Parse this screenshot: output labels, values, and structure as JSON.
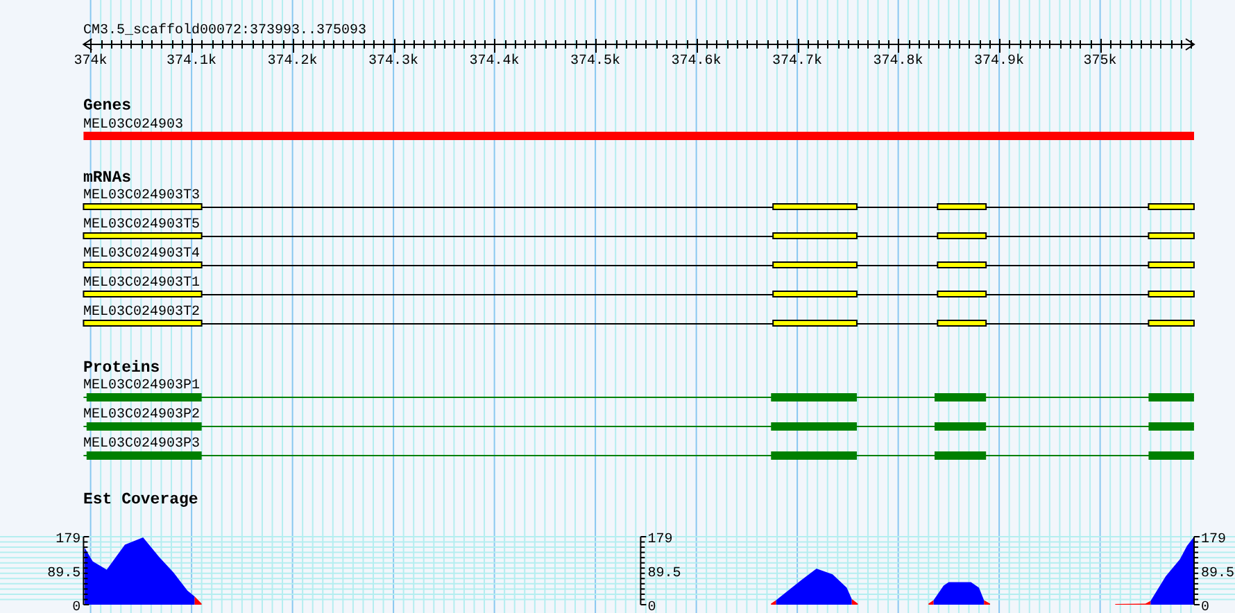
{
  "ruler": {
    "title": "CM3.5_scaffold00072:373993..375093",
    "ticks": [
      "374k",
      "374.1k",
      "374.2k",
      "374.3k",
      "374.4k",
      "374.5k",
      "374.6k",
      "374.7k",
      "374.8k",
      "374.9k",
      "375k"
    ]
  },
  "tracks": [
    {
      "kind": "gene",
      "title": "Genes",
      "features": [
        {
          "label": "MEL03C024903"
        }
      ]
    },
    {
      "kind": "mrna",
      "title": "mRNAs",
      "features": [
        {
          "label": "MEL03C024903T3"
        },
        {
          "label": "MEL03C024903T5"
        },
        {
          "label": "MEL03C024903T4"
        },
        {
          "label": "MEL03C024903T1"
        },
        {
          "label": "MEL03C024903T2"
        }
      ]
    },
    {
      "kind": "protein",
      "title": "Proteins",
      "features": [
        {
          "label": "MEL03C024903P1"
        },
        {
          "label": "MEL03C024903P2"
        },
        {
          "label": "MEL03C024903P3"
        }
      ]
    },
    {
      "kind": "coverage",
      "title": "Est Coverage",
      "axes": [
        {
          "labels": [
            "179",
            "89.5",
            "0"
          ]
        },
        {
          "labels": [
            "179",
            "89.5",
            "0"
          ]
        },
        {
          "labels": [
            "179",
            "89.5",
            "0"
          ]
        }
      ]
    }
  ]
}
